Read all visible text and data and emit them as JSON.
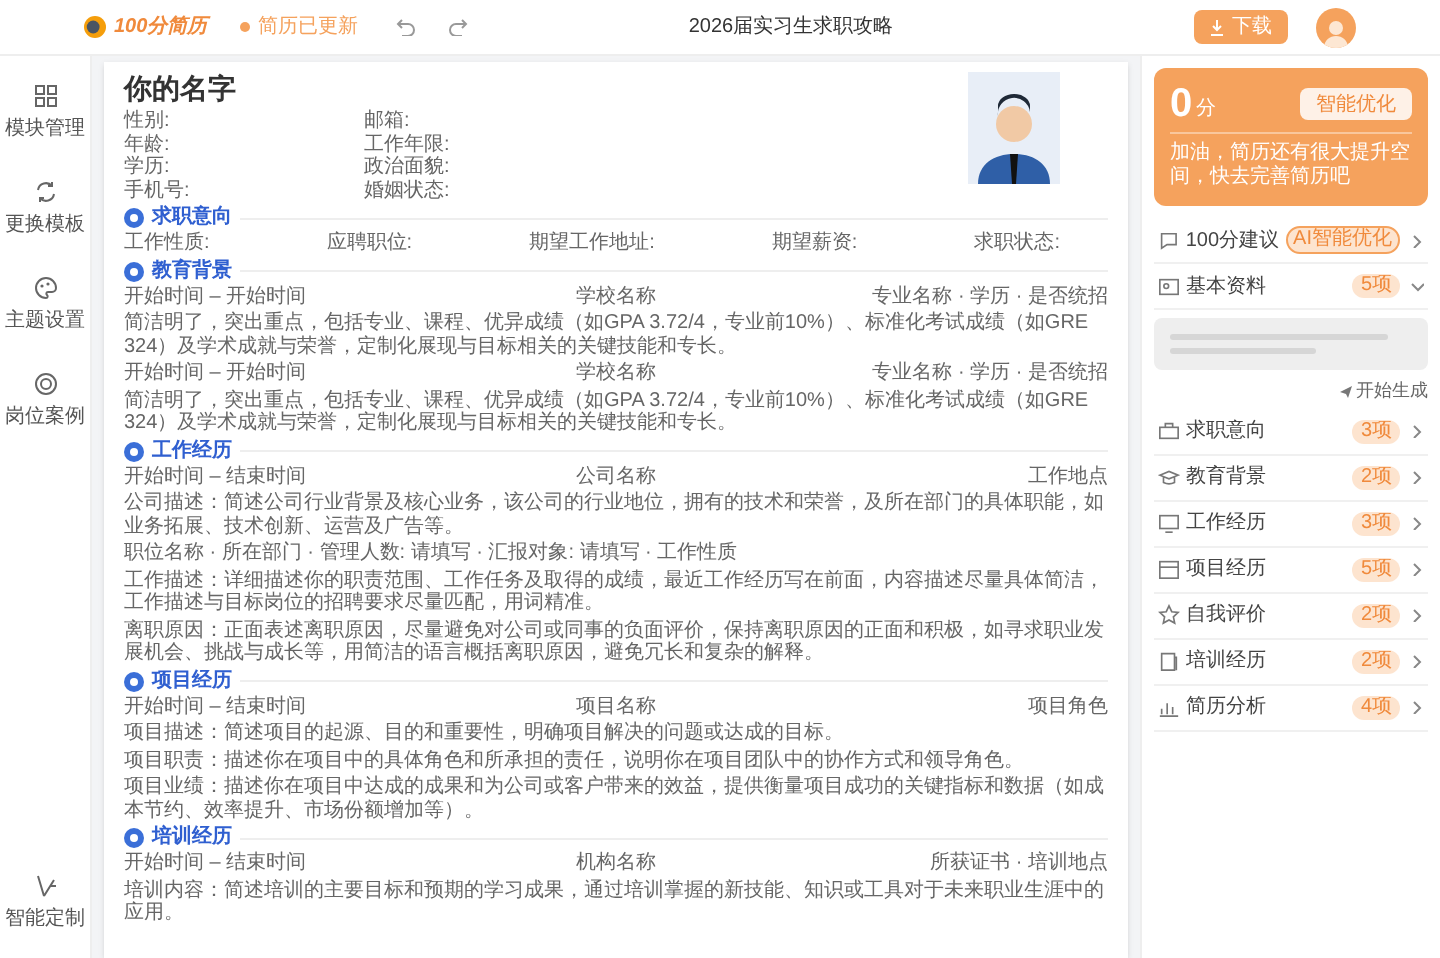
{
  "top_bar": {
    "logo_text": "100分简历",
    "save_status": "简历已更新",
    "title": "2026届实习生求职攻略",
    "download_button": "下载"
  },
  "sidebar": {
    "items": [
      {
        "label": "模块管理"
      },
      {
        "label": "更换模板"
      },
      {
        "label": "主题设置"
      },
      {
        "label": "岗位案例"
      }
    ],
    "bottom_item": {
      "label": "智能定制"
    }
  },
  "resume": {
    "name": "你的名字",
    "info_fields": [
      "性别:",
      "邮箱:",
      "年龄:",
      "工作年限:",
      "学历:",
      "政治面貌:",
      "手机号:",
      "婚姻状态:"
    ],
    "sections": [
      {
        "kind": "fields",
        "title": "求职意向",
        "fields": [
          "工作性质:",
          "应聘职位:",
          "期望工作地址:",
          "期望薪资:",
          "求职状态:"
        ]
      },
      {
        "kind": "entries",
        "title": "教育背景",
        "entries": [
          {
            "header": [
              "开始时间 – 开始时间",
              "学校名称",
              "专业名称 · 学历 · 是否统招"
            ],
            "lines": [
              "简洁明了，突出重点，包括专业、课程、优异成绩（如GPA 3.72/4，专业前10%）、标准化考试成绩（如GRE 324）及学术成就与荣誉，定制化展现与目标相关的关键技能和专长。"
            ]
          },
          {
            "header": [
              "开始时间 – 开始时间",
              "学校名称",
              "专业名称 · 学历 · 是否统招"
            ],
            "lines": [
              "简洁明了，突出重点，包括专业、课程、优异成绩（如GPA 3.72/4，专业前10%）、标准化考试成绩（如GRE 324）及学术成就与荣誉，定制化展现与目标相关的关键技能和专长。"
            ]
          }
        ]
      },
      {
        "kind": "entries",
        "title": "工作经历",
        "entries": [
          {
            "header": [
              "开始时间 – 结束时间",
              "公司名称",
              "工作地点"
            ],
            "lines": [
              "公司描述：简述公司行业背景及核心业务，该公司的行业地位，拥有的技术和荣誉，及所在部门的具体职能，如业务拓展、技术创新、运营及广告等。",
              "职位名称 · 所在部门 · 管理人数: 请填写 · 汇报对象: 请填写 · 工作性质",
              "工作描述：详细描述你的职责范围、工作任务及取得的成绩，最近工作经历写在前面，内容描述尽量具体简洁，工作描述与目标岗位的招聘要求尽量匹配，用词精准。",
              "离职原因：正面表述离职原因，尽量避免对公司或同事的负面评价，保持离职原因的正面和积极，如寻求职业发展机会、挑战与成长等，用简洁的语言概括离职原因，避免冗长和复杂的解释。"
            ]
          }
        ]
      },
      {
        "kind": "entries",
        "title": "项目经历",
        "entries": [
          {
            "header": [
              "开始时间 – 结束时间",
              "项目名称",
              "项目角色"
            ],
            "lines": [
              "项目描述：简述项目的起源、目的和重要性，明确项目解决的问题或达成的目标。",
              "项目职责：描述你在项目中的具体角色和所承担的责任，说明你在项目团队中的协作方式和领导角色。",
              "项目业绩：描述你在项目中达成的成果和为公司或客户带来的效益，提供衡量项目成功的关键指标和数据（如成本节约、效率提升、市场份额增加等）。"
            ]
          }
        ]
      },
      {
        "kind": "entries",
        "title": "培训经历",
        "entries": [
          {
            "header": [
              "开始时间 – 结束时间",
              "机构名称",
              "所获证书 · 培训地点"
            ],
            "lines": [
              "培训内容：简述培训的主要目标和预期的学习成果，通过培训掌握的新技能、知识或工具对于未来职业生涯中的应用。"
            ]
          }
        ]
      }
    ]
  },
  "score_card": {
    "value": "0",
    "unit": "分",
    "button": "智能优化",
    "message": "加油，简历还有很大提升空间，快去完善简历吧"
  },
  "panel_items": [
    {
      "kind": "suggest",
      "label": "100分建议",
      "badge": "AI智能优化"
    },
    {
      "kind": "module",
      "label": "基本资料",
      "badge": "5项",
      "expanded": true,
      "action": "开始生成"
    },
    {
      "kind": "module",
      "label": "求职意向",
      "badge": "3项",
      "expanded": false
    },
    {
      "kind": "module",
      "label": "教育背景",
      "badge": "2项",
      "expanded": false
    },
    {
      "kind": "module",
      "label": "工作经历",
      "badge": "3项",
      "expanded": false
    },
    {
      "kind": "module",
      "label": "项目经历",
      "badge": "5项",
      "expanded": false
    },
    {
      "kind": "module",
      "label": "自我评价",
      "badge": "2项",
      "expanded": false
    },
    {
      "kind": "module",
      "label": "培训经历",
      "badge": "2项",
      "expanded": false
    },
    {
      "kind": "module",
      "label": "简历分析",
      "badge": "4项",
      "expanded": false
    }
  ]
}
